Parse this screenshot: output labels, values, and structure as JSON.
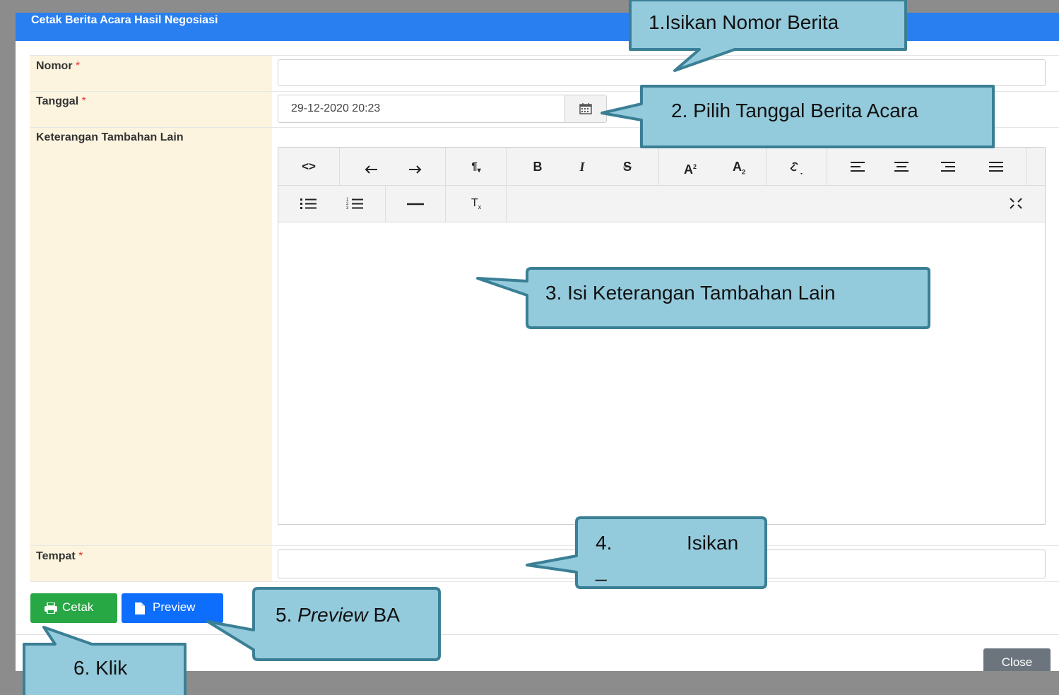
{
  "modal": {
    "title": "Cetak Berita Acara Hasil Negosiasi",
    "close_label": "Close"
  },
  "form": {
    "nomor_label": "Nomor",
    "tanggal_label": "Tanggal",
    "keterangan_label": "Keterangan Tambahan Lain",
    "tempat_label": "Tempat",
    "required_mark": "*",
    "nomor_value": "",
    "tanggal_value": "29-12-2020 20:23",
    "keterangan_value": "",
    "tempat_value": ""
  },
  "editor_toolbar": {
    "row1": [
      "code-view",
      "undo",
      "redo",
      "paragraph-style",
      "bold",
      "italic",
      "strikethrough",
      "superscript",
      "subscript",
      "link",
      "align-left",
      "align-center",
      "align-right",
      "align-justify"
    ],
    "row2": [
      "unordered-list",
      "ordered-list",
      "horizontal-rule",
      "clear-format",
      "fullscreen"
    ]
  },
  "buttons": {
    "cetak_label": "Cetak",
    "preview_label": "Preview"
  },
  "callouts": {
    "c1": "1.Isikan Nomor Berita",
    "c2": "2. Pilih Tanggal Berita Acara",
    "c3": "3. Isi Keterangan Tambahan Lain",
    "c4_num": "4.",
    "c4_text": "Isikan",
    "c4_extra": "_",
    "c5_num": "5.",
    "c5_italic": "Preview",
    "c5_rest": "BA",
    "c6": "6. Klik"
  },
  "colors": {
    "header": "#2a7ff0",
    "label_bg": "#fcf4df",
    "cetak_button": "#28a745",
    "preview_button": "#0d6efd",
    "close_button": "#6c757d",
    "callout_fill": "#94cbdc",
    "callout_border": "#3a7f95"
  }
}
